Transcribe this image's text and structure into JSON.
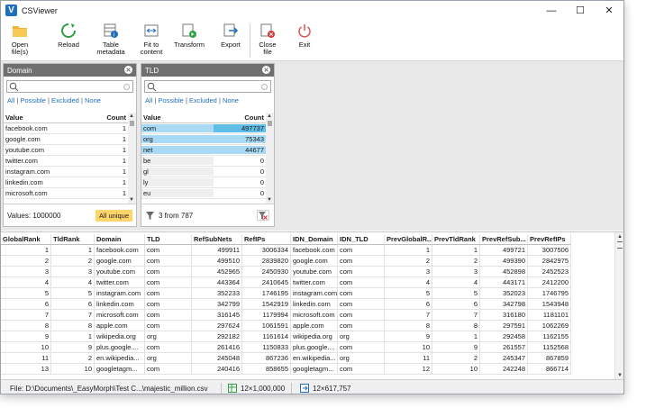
{
  "window": {
    "title": "CSViewer",
    "controls": {
      "minimize": "—",
      "maximize": "☐",
      "close": "✕"
    }
  },
  "toolbar": [
    {
      "key": "open",
      "label": "Open\nfile(s)",
      "icon": "folder-icon"
    },
    {
      "key": "reload",
      "label": "Reload",
      "icon": "reload-icon"
    },
    {
      "key": "table_metadata",
      "label": "Table\nmetadata",
      "icon": "table-info-icon"
    },
    {
      "key": "fit",
      "label": "Fit to\ncontent",
      "icon": "fit-width-icon"
    },
    {
      "key": "transform",
      "label": "Transform",
      "icon": "transform-icon"
    },
    {
      "key": "export",
      "label": "Export",
      "icon": "export-icon"
    },
    {
      "key": "close_file",
      "label": "Close\nfile",
      "icon": "close-file-icon"
    },
    {
      "key": "exit",
      "label": "Exit",
      "icon": "power-icon"
    }
  ],
  "filters": {
    "all": "All",
    "possible": "Possible",
    "excluded": "Excluded",
    "none": "None",
    "sep": "|"
  },
  "domain_panel": {
    "title": "Domain",
    "col_value": "Value",
    "col_count": "Count",
    "rows": [
      {
        "value": "facebook.com",
        "count": "1"
      },
      {
        "value": "google.com",
        "count": "1"
      },
      {
        "value": "youtube.com",
        "count": "1"
      },
      {
        "value": "twitter.com",
        "count": "1"
      },
      {
        "value": "instagram.com",
        "count": "1"
      },
      {
        "value": "linkedin.com",
        "count": "1"
      },
      {
        "value": "microsoft.com",
        "count": "1"
      }
    ],
    "footer_text": "Values: 1000000",
    "badge": "All unique"
  },
  "tld_panel": {
    "title": "TLD",
    "col_value": "Value",
    "col_count": "Count",
    "rows": [
      {
        "value": "com",
        "count": "497737"
      },
      {
        "value": "org",
        "count": "75343"
      },
      {
        "value": "net",
        "count": "44677"
      },
      {
        "value": "be",
        "count": "0"
      },
      {
        "value": "gl",
        "count": "0"
      },
      {
        "value": "ly",
        "count": "0"
      },
      {
        "value": "eu",
        "count": "0"
      }
    ],
    "footer_text": "3 from 787"
  },
  "grid": {
    "headers": [
      "GlobalRank",
      "TldRank",
      "Domain",
      "TLD",
      "RefSubNets",
      "RefIPs",
      "IDN_Domain",
      "IDN_TLD",
      "PrevGlobalR...",
      "PrevTldRank",
      "PrevRefSub...",
      "PrevRefIPs"
    ],
    "rows": [
      [
        "1",
        "1",
        "facebook.com",
        "com",
        "499911",
        "3006334",
        "facebook.com",
        "com",
        "1",
        "1",
        "499721",
        "3007506"
      ],
      [
        "2",
        "2",
        "google.com",
        "com",
        "499510",
        "2839820",
        "google.com",
        "com",
        "2",
        "2",
        "499390",
        "2842975"
      ],
      [
        "3",
        "3",
        "youtube.com",
        "com",
        "452965",
        "2450930",
        "youtube.com",
        "com",
        "3",
        "3",
        "452898",
        "2452523"
      ],
      [
        "4",
        "4",
        "twitter.com",
        "com",
        "443364",
        "2410645",
        "twitter.com",
        "com",
        "4",
        "4",
        "443171",
        "2412200"
      ],
      [
        "5",
        "5",
        "instagram.com",
        "com",
        "352233",
        "1746195",
        "instagram.com",
        "com",
        "5",
        "5",
        "352023",
        "1746795"
      ],
      [
        "6",
        "6",
        "linkedin.com",
        "com",
        "342799",
        "1542919",
        "linkedin.com",
        "com",
        "6",
        "6",
        "342798",
        "1543948"
      ],
      [
        "7",
        "7",
        "microsoft.com",
        "com",
        "316145",
        "1179994",
        "microsoft.com",
        "com",
        "7",
        "7",
        "316180",
        "1181101"
      ],
      [
        "8",
        "8",
        "apple.com",
        "com",
        "297624",
        "1061591",
        "apple.com",
        "com",
        "8",
        "8",
        "297591",
        "1062269"
      ],
      [
        "9",
        "1",
        "wikipedia.org",
        "org",
        "292182",
        "1161614",
        "wikipedia.org",
        "org",
        "9",
        "1",
        "292458",
        "1162155"
      ],
      [
        "10",
        "9",
        "plus.google....",
        "com",
        "261416",
        "1150833",
        "plus.google....",
        "com",
        "10",
        "9",
        "261557",
        "1152568"
      ],
      [
        "11",
        "2",
        "en.wikipedia...",
        "org",
        "245048",
        "867236",
        "en.wikipedia...",
        "org",
        "11",
        "2",
        "245347",
        "867859"
      ],
      [
        "13",
        "10",
        "googletagm...",
        "com",
        "240416",
        "858655",
        "googletagm...",
        "com",
        "12",
        "10",
        "242248",
        "866714"
      ]
    ]
  },
  "status": {
    "file": "File:  D:\\Documents\\_EasyMorph\\Test C...\\majestic_million.csv",
    "dims": "12×1,000,000",
    "filtered": "12×617,757"
  }
}
